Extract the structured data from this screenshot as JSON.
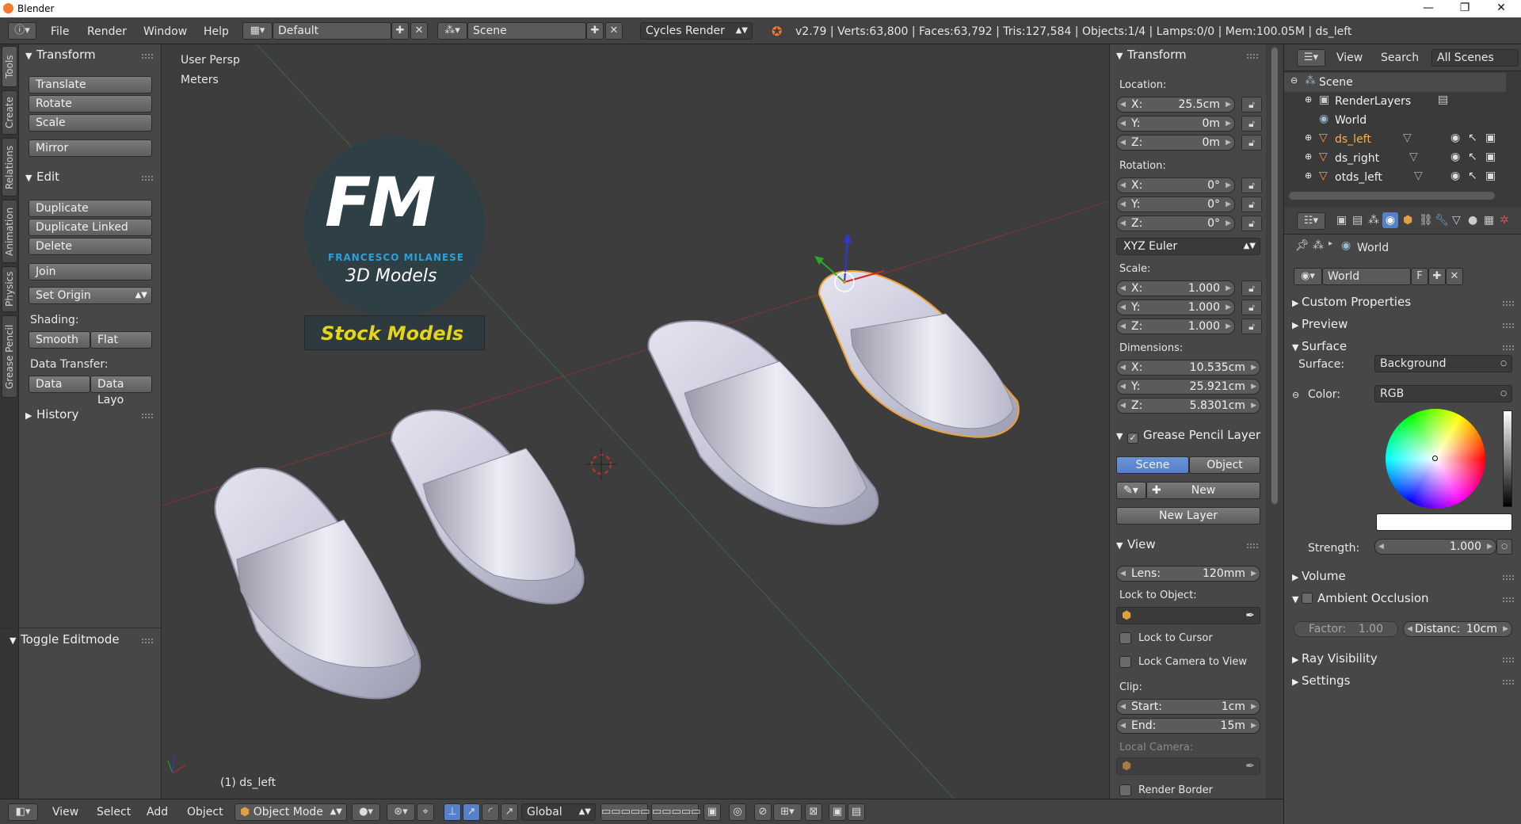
{
  "os_window": {
    "title": "Blender",
    "min": "—",
    "max": "❐",
    "close": "✕"
  },
  "header": {
    "menus": [
      "File",
      "Render",
      "Window",
      "Help"
    ],
    "screen_layout": "Default",
    "scene": "Scene",
    "render_engine": "Cycles Render",
    "stats": "v2.79 | Verts:63,800 | Faces:63,792 | Tris:127,584 | Objects:1/4 | Lamps:0/0 | Mem:100.05M | ds_left"
  },
  "left_tabs": [
    "Tools",
    "Create",
    "Relations",
    "Animation",
    "Physics",
    "Grease Pencil"
  ],
  "tool_shelf": {
    "transform_title": "Transform",
    "translate": "Translate",
    "rotate": "Rotate",
    "scale": "Scale",
    "mirror": "Mirror",
    "edit_title": "Edit",
    "duplicate": "Duplicate",
    "duplicate_linked": "Duplicate Linked",
    "delete": "Delete",
    "join": "Join",
    "set_origin": "Set Origin",
    "shading_label": "Shading:",
    "smooth": "Smooth",
    "flat": "Flat",
    "data_transfer_label": "Data Transfer:",
    "data": "Data",
    "data_layout": "Data Layo",
    "history_title": "History",
    "toggle_editmode": "Toggle Editmode"
  },
  "viewport": {
    "view_name": "User Persp",
    "units": "Meters",
    "active_object": "(1) ds_left",
    "logo": {
      "letters": "FM",
      "name": "FRANCESCO MILANESE",
      "sub": "3D Models",
      "banner": "Stock Models"
    }
  },
  "n_panel": {
    "transform_title": "Transform",
    "location_label": "Location:",
    "location": [
      {
        "k": "X:",
        "v": "25.5cm"
      },
      {
        "k": "Y:",
        "v": "0m"
      },
      {
        "k": "Z:",
        "v": "0m"
      }
    ],
    "rotation_label": "Rotation:",
    "rotation": [
      {
        "k": "X:",
        "v": "0°"
      },
      {
        "k": "Y:",
        "v": "0°"
      },
      {
        "k": "Z:",
        "v": "0°"
      }
    ],
    "rotation_mode": "XYZ Euler",
    "scale_label": "Scale:",
    "scale": [
      {
        "k": "X:",
        "v": "1.000"
      },
      {
        "k": "Y:",
        "v": "1.000"
      },
      {
        "k": "Z:",
        "v": "1.000"
      }
    ],
    "dimensions_label": "Dimensions:",
    "dimensions": [
      {
        "k": "X:",
        "v": "10.535cm"
      },
      {
        "k": "Y:",
        "v": "25.921cm"
      },
      {
        "k": "Z:",
        "v": "5.8301cm"
      }
    ],
    "gp_title": "Grease Pencil Layer",
    "gp_scene": "Scene",
    "gp_object": "Object",
    "gp_new": "New",
    "gp_new_layer": "New Layer",
    "view_title": "View",
    "lens_label": "Lens:",
    "lens_value": "120mm",
    "lock_to_object": "Lock to Object:",
    "lock_to_cursor": "Lock to Cursor",
    "lock_camera": "Lock Camera to View",
    "clip_label": "Clip:",
    "clip_start_k": "Start:",
    "clip_start_v": "1cm",
    "clip_end_k": "End:",
    "clip_end_v": "15m",
    "local_camera": "Local Camera:",
    "render_border": "Render Border"
  },
  "outliner": {
    "view": "View",
    "search": "Search",
    "filter": "All Scenes",
    "items": [
      {
        "label": "Scene"
      },
      {
        "label": "RenderLayers"
      },
      {
        "label": "World"
      },
      {
        "label": "ds_left"
      },
      {
        "label": "ds_right"
      },
      {
        "label": "otds_left"
      }
    ]
  },
  "properties": {
    "breadcrumb": "World",
    "world_name": "World",
    "fake_user": "F",
    "sections": {
      "custom": "Custom Properties",
      "preview": "Preview",
      "surface": "Surface",
      "volume": "Volume",
      "ao": "Ambient Occlusion",
      "ray": "Ray Visibility",
      "settings": "Settings"
    },
    "surface_label": "Surface:",
    "surface_value": "Background",
    "color_label": "Color:",
    "color_value": "RGB",
    "strength_label": "Strength:",
    "strength_value": "1.000",
    "factor_label": "Factor:",
    "factor_value": "1.00",
    "distance_label": "Distanc:",
    "distance_value": "10cm"
  },
  "bottom": {
    "view": "View",
    "select": "Select",
    "add": "Add",
    "object": "Object",
    "mode": "Object Mode",
    "orientation": "Global"
  },
  "colors": {
    "accent_blue": "#5680c8",
    "selected_orange": "#f0a030",
    "panel": "#474747",
    "viewport": "#3d3d3d"
  }
}
